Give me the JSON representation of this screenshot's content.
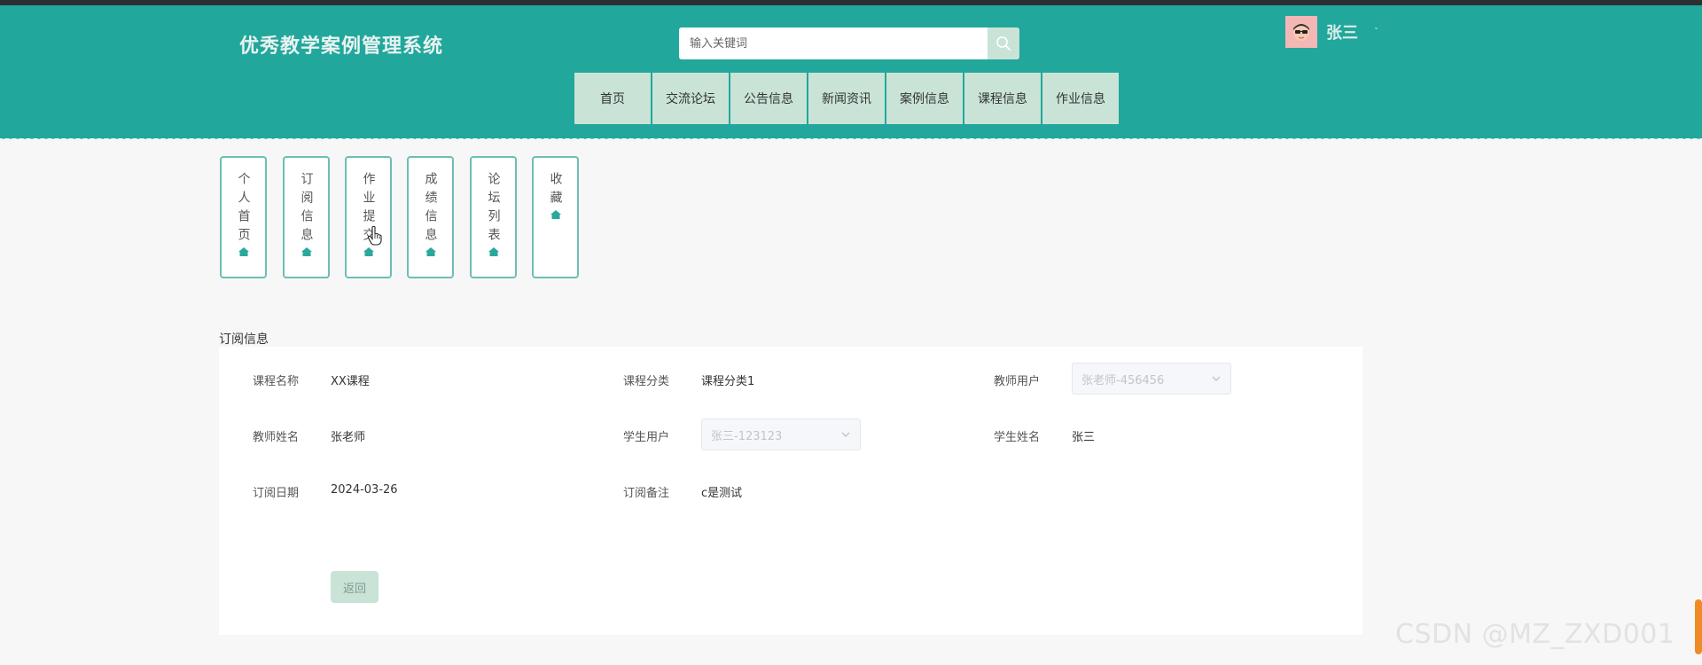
{
  "header": {
    "site_title": "优秀教学案例管理系统",
    "search_placeholder": "输入关键词",
    "username": "张三",
    "user_caret": "ˇ"
  },
  "nav": {
    "items": [
      {
        "label": "首页"
      },
      {
        "label": "交流论坛"
      },
      {
        "label": "公告信息"
      },
      {
        "label": "新闻资讯"
      },
      {
        "label": "案例信息"
      },
      {
        "label": "课程信息"
      },
      {
        "label": "作业信息"
      }
    ]
  },
  "side_tabs": {
    "items": [
      {
        "label": "个人首页"
      },
      {
        "label": "订阅信息"
      },
      {
        "label": "作业提交"
      },
      {
        "label": "成绩信息"
      },
      {
        "label": "论坛列表"
      },
      {
        "label": "收藏"
      }
    ]
  },
  "section": {
    "title": "订阅信息"
  },
  "form": {
    "course_name_label": "课程名称",
    "course_name_value": "XX课程",
    "course_category_label": "课程分类",
    "course_category_value": "课程分类1",
    "teacher_user_label": "教师用户",
    "teacher_user_value": "张老师-456456",
    "teacher_name_label": "教师姓名",
    "teacher_name_value": "张老师",
    "student_user_label": "学生用户",
    "student_user_value": "张三-123123",
    "student_name_label": "学生姓名",
    "student_name_value": "张三",
    "subscribe_date_label": "订阅日期",
    "subscribe_date_value": "2024-03-26",
    "subscribe_note_label": "订阅备注",
    "subscribe_note_value": "c是测试",
    "back_label": "返回"
  },
  "watermark": {
    "text": "CSDN @MZ_ZXD001"
  },
  "colors": {
    "header_bg": "#21a79b",
    "nav_bg": "#c9e4d7",
    "tab_border": "#6bbfb5"
  }
}
